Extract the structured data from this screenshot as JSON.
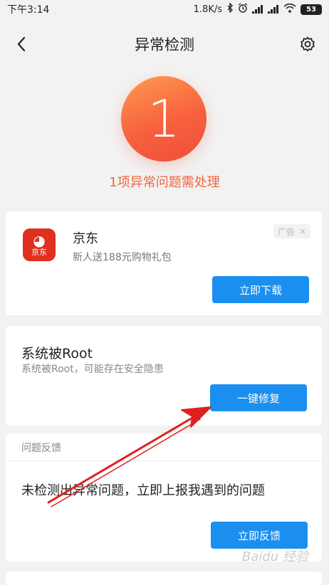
{
  "status_bar": {
    "time": "下午3:14",
    "network_speed": "1.8K/s",
    "battery": "53"
  },
  "header": {
    "title": "异常检测",
    "back_icon": "chevron-left-icon",
    "settings_icon": "gear-icon"
  },
  "summary": {
    "count": "1",
    "text": "1项异常问题需处理",
    "accent_color": "#f0643f"
  },
  "ad_card": {
    "app_name": "京东",
    "description": "新人送188元购物礼包",
    "badge": "广告",
    "badge_close": "×",
    "logo_text": "京东",
    "button": "立即下载"
  },
  "root_card": {
    "title": "系统被Root",
    "description": "系统被Root，可能存在安全隐患",
    "button": "一键修复"
  },
  "feedback_card": {
    "header": "问题反馈",
    "text": "未检测出异常问题，立即上报我遇到的问题",
    "button": "立即反馈"
  },
  "watermark": "Baidu 经验",
  "colors": {
    "primary_button": "#1a8fef",
    "arrow": "#e02020"
  }
}
